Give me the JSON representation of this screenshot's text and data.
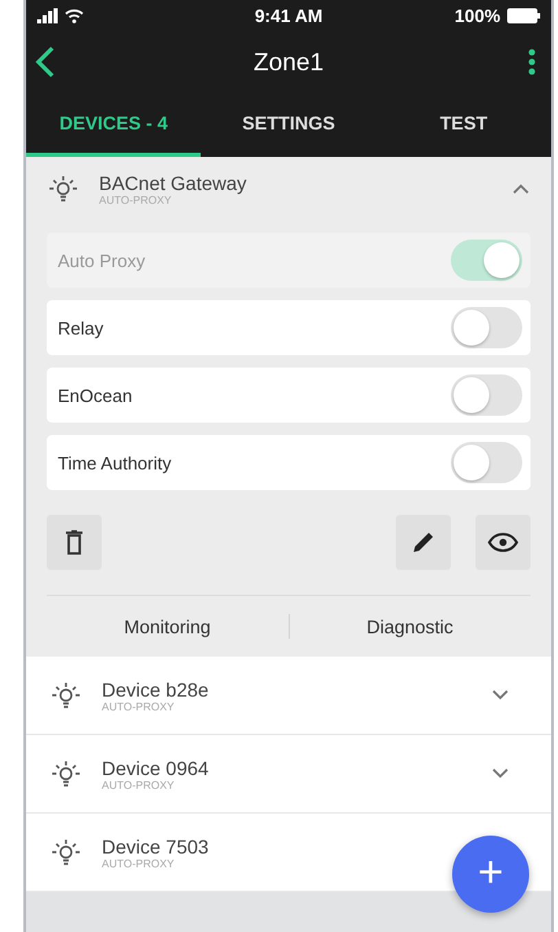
{
  "status_bar": {
    "time": "9:41 AM",
    "battery": "100%"
  },
  "header": {
    "title": "Zone1"
  },
  "tabs": [
    {
      "label": "DEVICES - 4",
      "selected": true
    },
    {
      "label": "SETTINGS",
      "selected": false
    },
    {
      "label": "TEST",
      "selected": false
    }
  ],
  "expanded_device": {
    "name": "BACnet Gateway",
    "subtitle": "AUTO-PROXY",
    "expanded": true,
    "toggles": [
      {
        "label": "Auto Proxy",
        "on": true,
        "disabled": true
      },
      {
        "label": "Relay",
        "on": false,
        "disabled": false
      },
      {
        "label": "EnOcean",
        "on": false,
        "disabled": false
      },
      {
        "label": "Time Authority",
        "on": false,
        "disabled": false
      }
    ],
    "links": [
      "Monitoring",
      "Diagnostic"
    ]
  },
  "devices": [
    {
      "name": "Device b28e",
      "subtitle": "AUTO-PROXY",
      "expanded": false
    },
    {
      "name": "Device 0964",
      "subtitle": "AUTO-PROXY",
      "expanded": false
    },
    {
      "name": "Device 7503",
      "subtitle": "AUTO-PROXY"
    }
  ],
  "fab": {
    "label": "+"
  }
}
